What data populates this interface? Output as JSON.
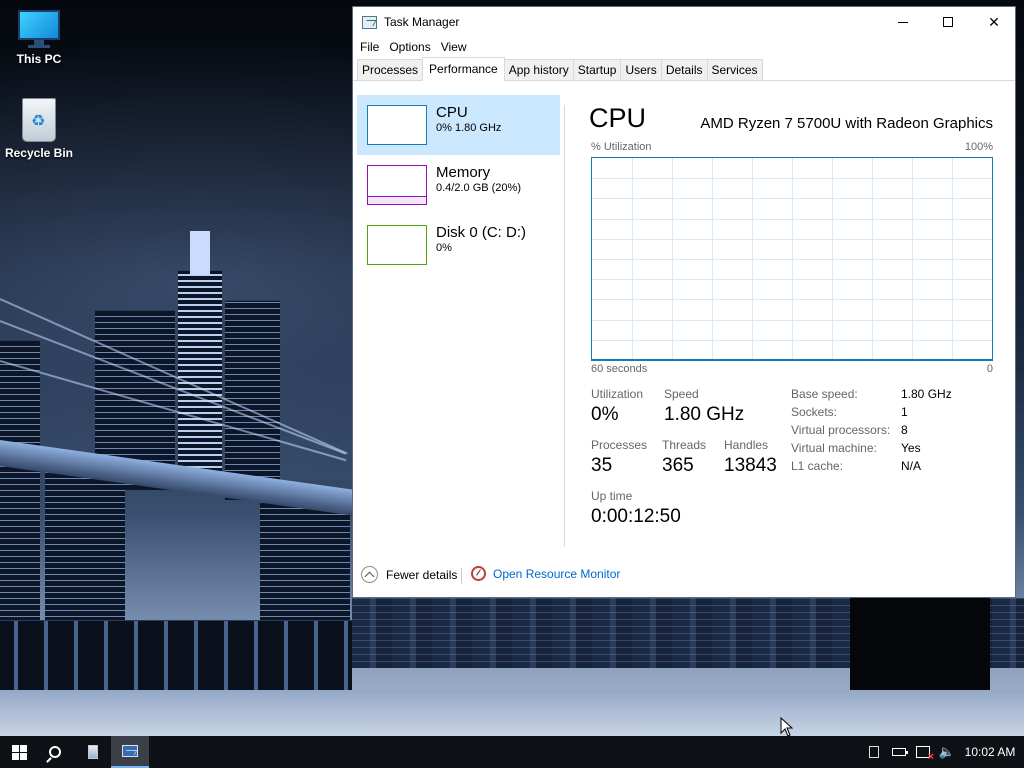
{
  "desktop": {
    "icons": [
      {
        "label": "This PC",
        "icon": "monitor-icon"
      },
      {
        "label": "Recycle Bin",
        "icon": "recycle-bin-icon"
      }
    ]
  },
  "window": {
    "title": "Task Manager",
    "controls": {
      "minimize": "minimize-icon",
      "maximize": "maximize-icon",
      "close": "close-icon",
      "close_label": "✕"
    }
  },
  "menu": [
    "File",
    "Options",
    "View"
  ],
  "tabs": [
    "Processes",
    "Performance",
    "App history",
    "Startup",
    "Users",
    "Details",
    "Services"
  ],
  "selected_tab": "Performance",
  "sidebar": [
    {
      "title": "CPU",
      "subtitle": "0% 1.80 GHz",
      "color": "#117dbb",
      "selected": true
    },
    {
      "title": "Memory",
      "subtitle": "0.4/2.0 GB (20%)",
      "color": "#8b12ae",
      "fill_fraction": 0.2
    },
    {
      "title": "Disk 0 (C: D:)",
      "subtitle": "0%",
      "color": "#4da60c"
    }
  ],
  "main": {
    "title": "CPU",
    "model": "AMD Ryzen 7 5700U with Radeon Graphics",
    "graph": {
      "y_label": "% Utilization",
      "y_max_label": "100%",
      "x_left_label": "60 seconds",
      "x_right_label": "0",
      "line_color": "#117dbb",
      "grid_color": "#d9eaf7"
    },
    "stats": {
      "utilization_label": "Utilization",
      "utilization": "0%",
      "speed_label": "Speed",
      "speed": "1.80 GHz",
      "processes_label": "Processes",
      "processes": "35",
      "threads_label": "Threads",
      "threads": "365",
      "handles_label": "Handles",
      "handles": "13843",
      "uptime_label": "Up time",
      "uptime": "0:00:12:50"
    },
    "specs": [
      {
        "key": "Base speed:",
        "value": "1.80 GHz"
      },
      {
        "key": "Sockets:",
        "value": "1"
      },
      {
        "key": "Virtual processors:",
        "value": "8"
      },
      {
        "key": "Virtual machine:",
        "value": "Yes"
      },
      {
        "key": "L1 cache:",
        "value": "N/A"
      }
    ]
  },
  "footer": {
    "fewer_details": "Fewer details",
    "open_resource_monitor": "Open Resource Monitor"
  },
  "taskbar": {
    "buttons": [
      "start-icon",
      "search-icon",
      "file-cabinet-icon",
      "task-manager-icon"
    ],
    "tray": [
      "action-center-icon",
      "battery-icon",
      "network-error-icon",
      "volume-icon"
    ],
    "time": "10:02 AM"
  }
}
